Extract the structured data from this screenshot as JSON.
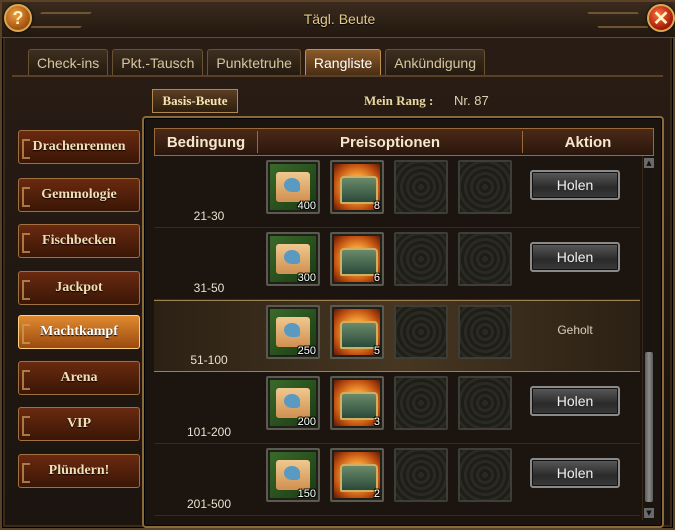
{
  "window": {
    "title": "Tägl. Beute",
    "help_label": "?",
    "close_label": "✕"
  },
  "tabs": [
    {
      "label": "Check-ins",
      "active": false
    },
    {
      "label": "Pkt.-Tausch",
      "active": false
    },
    {
      "label": "Punktetruhe",
      "active": false
    },
    {
      "label": "Rangliste",
      "active": true
    },
    {
      "label": "Ankündigung",
      "active": false
    }
  ],
  "sub_tab": "Basis-Beute",
  "rank": {
    "label": "Mein Rang :",
    "value": "Nr. 87"
  },
  "sidebar": [
    {
      "label": "Drachenrennen",
      "active": false
    },
    {
      "label": "Gemmologie",
      "active": false
    },
    {
      "label": "Fischbecken",
      "active": false
    },
    {
      "label": "Jackpot",
      "active": false
    },
    {
      "label": "Machtkampf",
      "active": true
    },
    {
      "label": "Arena",
      "active": false
    },
    {
      "label": "VIP",
      "active": false
    },
    {
      "label": "Plündern!",
      "active": false
    }
  ],
  "table": {
    "headers": {
      "condition": "Bedingung",
      "rewards": "Preisoptionen",
      "action": "Aktion"
    },
    "rows": [
      {
        "range": "21-30",
        "scroll_qty": "400",
        "chest_qty": "8",
        "action": "Holen",
        "claimed": false
      },
      {
        "range": "31-50",
        "scroll_qty": "300",
        "chest_qty": "6",
        "action": "Holen",
        "claimed": false
      },
      {
        "range": "51-100",
        "scroll_qty": "250",
        "chest_qty": "5",
        "action": "Geholt",
        "claimed": true
      },
      {
        "range": "101-200",
        "scroll_qty": "200",
        "chest_qty": "3",
        "action": "Holen",
        "claimed": false
      },
      {
        "range": "201-500",
        "scroll_qty": "150",
        "chest_qty": "2",
        "action": "Holen",
        "claimed": false
      }
    ]
  },
  "icons": {
    "scroll": "scroll-icon",
    "chest": "treasure-chest-icon",
    "empty_slot": "empty-slot"
  }
}
